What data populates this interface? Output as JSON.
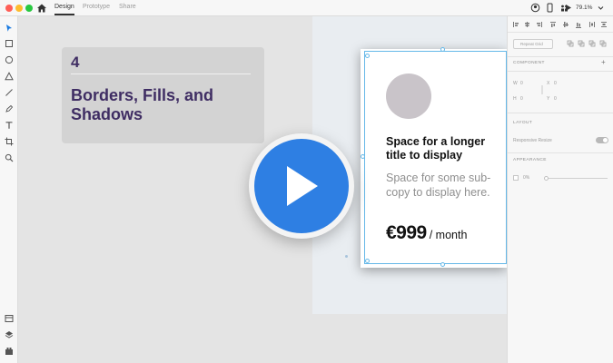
{
  "titlebar": {
    "tabs": [
      {
        "label": "Design",
        "active": true
      },
      {
        "label": "Prototype",
        "active": false
      },
      {
        "label": "Share",
        "active": false
      }
    ],
    "zoom": "79.1%",
    "icons": [
      "home-icon",
      "user-icon",
      "phone-preview-icon",
      "share-people-icon",
      "play-preview-icon",
      "chevron-down-icon"
    ]
  },
  "toolbar": {
    "tools": [
      "select-tool",
      "rectangle-tool",
      "ellipse-tool",
      "triangle-tool",
      "line-tool",
      "pen-tool",
      "text-tool",
      "artboard-tool",
      "zoom-tool"
    ],
    "bottom": [
      "assets-icon",
      "layers-icon",
      "plugins-icon"
    ]
  },
  "canvas": {
    "lesson": {
      "number": "4",
      "title": "Borders, Fills, and Shadows"
    },
    "card": {
      "title": "Space for a longer title to display",
      "subcopy": "Space for some sub-copy to display here.",
      "price": "€999",
      "period": "/ month"
    }
  },
  "panel": {
    "repeat_grid": "Repeat Grid",
    "component": "COMPONENT",
    "component_add": "+",
    "w_label": "W",
    "w_value": "0",
    "x_label": "X",
    "x_value": "0",
    "h_label": "H",
    "h_value": "0",
    "y_label": "Y",
    "y_value": "0",
    "layout": "LAYOUT",
    "responsive_resize": "Responsive Resize",
    "appearance": "APPEARANCE",
    "opacity": "0%"
  },
  "colors": {
    "accent_play": "#2e7fe3",
    "lesson_title": "#3f2d63",
    "selection": "#65b8e8",
    "traffic_red": "#ff5f57",
    "traffic_yellow": "#febc2e",
    "traffic_green": "#28c840"
  }
}
